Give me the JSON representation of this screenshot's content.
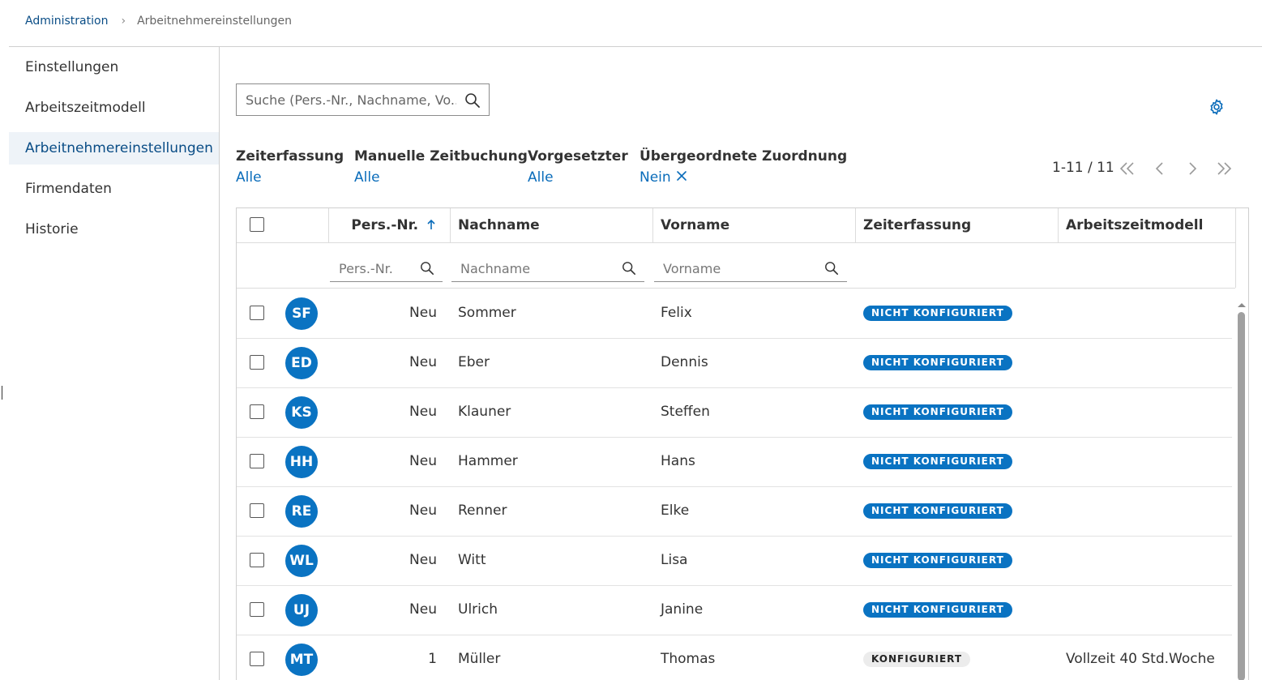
{
  "breadcrumb": {
    "parent": "Administration",
    "current": "Arbeitnehmereinstellungen"
  },
  "sidebar": {
    "items": [
      {
        "label": "Einstellungen",
        "active": false
      },
      {
        "label": "Arbeitszeitmodell",
        "active": false
      },
      {
        "label": "Arbeitnehmereinstellungen",
        "active": true
      },
      {
        "label": "Firmendaten",
        "active": false
      },
      {
        "label": "Historie",
        "active": false
      }
    ]
  },
  "search": {
    "placeholder": "Suche (Pers.-Nr., Nachname, Vo..."
  },
  "filters": [
    {
      "label": "Zeiterfassung",
      "value": "Alle"
    },
    {
      "label": "Manuelle Zeitbuchung",
      "value": "Alle"
    },
    {
      "label": "Vorgesetzter",
      "value": "Alle"
    },
    {
      "label": "Übergeordnete Zuordnung",
      "value": "Nein"
    }
  ],
  "pagination": {
    "range": "1-11 / 11"
  },
  "table": {
    "columns": [
      "Pers.-Nr.",
      "Nachname",
      "Vorname",
      "Zeiterfassung",
      "Arbeitszeitmodell"
    ],
    "sort": {
      "column": "Pers.-Nr.",
      "direction": "ascending"
    },
    "column_filters": {
      "persnr": "Pers.-Nr.",
      "nachname": "Nachname",
      "vorname": "Vorname"
    },
    "rows": [
      {
        "initials": "SF",
        "persnr": "Neu",
        "nachname": "Sommer",
        "vorname": "Felix",
        "status": "NICHT KONFIGURIERT",
        "modell": ""
      },
      {
        "initials": "ED",
        "persnr": "Neu",
        "nachname": "Eber",
        "vorname": "Dennis",
        "status": "NICHT KONFIGURIERT",
        "modell": ""
      },
      {
        "initials": "KS",
        "persnr": "Neu",
        "nachname": "Klauner",
        "vorname": "Steffen",
        "status": "NICHT KONFIGURIERT",
        "modell": ""
      },
      {
        "initials": "HH",
        "persnr": "Neu",
        "nachname": "Hammer",
        "vorname": "Hans",
        "status": "NICHT KONFIGURIERT",
        "modell": ""
      },
      {
        "initials": "RE",
        "persnr": "Neu",
        "nachname": "Renner",
        "vorname": "Elke",
        "status": "NICHT KONFIGURIERT",
        "modell": ""
      },
      {
        "initials": "WL",
        "persnr": "Neu",
        "nachname": "Witt",
        "vorname": "Lisa",
        "status": "NICHT KONFIGURIERT",
        "modell": ""
      },
      {
        "initials": "UJ",
        "persnr": "Neu",
        "nachname": "Ulrich",
        "vorname": "Janine",
        "status": "NICHT KONFIGURIERT",
        "modell": ""
      },
      {
        "initials": "MT",
        "persnr": "1",
        "nachname": "Müller",
        "vorname": "Thomas",
        "status": "KONFIGURIERT",
        "modell": "Vollzeit 40 Std.Woche"
      }
    ]
  },
  "colors": {
    "accent": "#0a73c2",
    "link": "#0a6cba",
    "nav_active_bg": "#eef3f8",
    "badge_configured_bg": "#ececec"
  },
  "icons": [
    "search-icon",
    "gear-icon",
    "close-icon",
    "sort-ascending-icon",
    "first-page-icon",
    "previous-page-icon",
    "next-page-icon",
    "last-page-icon"
  ]
}
